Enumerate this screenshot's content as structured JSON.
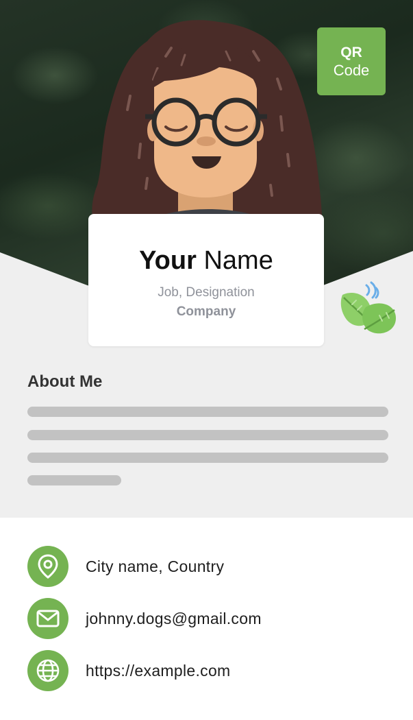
{
  "qr_button": {
    "line1": "QR",
    "line2": "Code"
  },
  "profile": {
    "first_name": "Your",
    "last_name": "Name",
    "job": "Job, Designation",
    "company": "Company"
  },
  "about": {
    "title": "About Me"
  },
  "contacts": [
    {
      "icon": "location-pin-icon",
      "text": "City name, Country"
    },
    {
      "icon": "mail-icon",
      "text": "johnny.dogs@gmail.com"
    },
    {
      "icon": "globe-icon",
      "text": "https://example.com"
    }
  ],
  "colors": {
    "accent": "#75b352",
    "grey_bg": "#efefef",
    "placeholder_bar": "#c2c2c2",
    "hair": "#4a2c28",
    "skin": "#efb889"
  }
}
